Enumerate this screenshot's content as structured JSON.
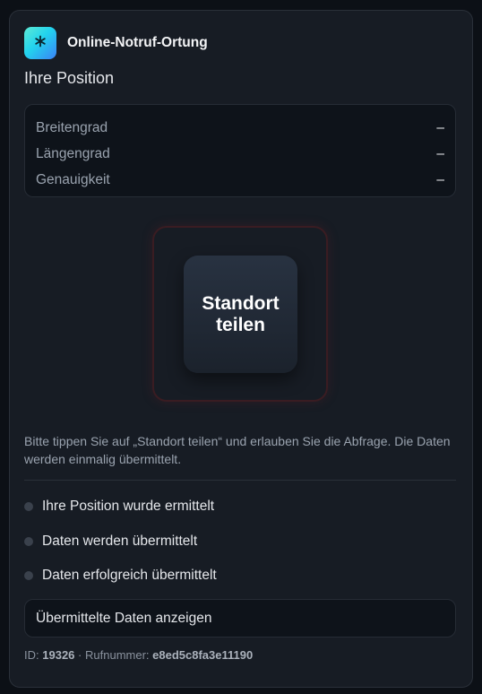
{
  "app": {
    "title": "Online-Notruf-Ortung",
    "logo_icon": "asterisk-icon"
  },
  "position": {
    "title": "Ihre Position",
    "rows": [
      {
        "label": "Breitengrad",
        "value": "–"
      },
      {
        "label": "Längengrad",
        "value": "–"
      },
      {
        "label": "Genauigkeit",
        "value": "–"
      }
    ]
  },
  "share": {
    "label": "Standort\nteilen"
  },
  "hint": "Bitte tippen Sie auf „Standort teilen“ und erlauben Sie die Abfrage. Die Daten werden einmalig übermittelt.",
  "steps": [
    {
      "label": "Ihre Position wurde ermittelt",
      "done": false
    },
    {
      "label": "Daten werden übermittelt",
      "done": false
    },
    {
      "label": "Daten erfolgreich übermittelt",
      "done": false
    }
  ],
  "details_button": "Übermittelte Daten anzeigen",
  "footer": {
    "id_label": "ID:",
    "id_value": "19326",
    "separator": "·",
    "phone_label": "Rufnummer:",
    "phone_value": "e8ed5c8fa3e11190"
  },
  "colors": {
    "background": "#0c1016",
    "card": "#171c24",
    "logo_gradient_start": "#5eead4",
    "logo_gradient_end": "#3b82f6",
    "frame_border": "#3a1c22"
  }
}
